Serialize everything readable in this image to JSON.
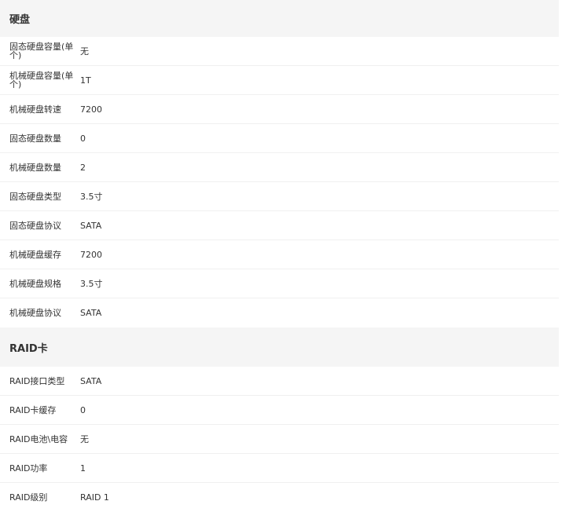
{
  "sections": [
    {
      "title": "硬盘",
      "rows": [
        {
          "label": "固态硬盘容量(单个)",
          "value": "无"
        },
        {
          "label": "机械硬盘容量(单个)",
          "value": "1T"
        },
        {
          "label": "机械硬盘转速",
          "value": "7200"
        },
        {
          "label": "固态硬盘数量",
          "value": "0"
        },
        {
          "label": "机械硬盘数量",
          "value": "2"
        },
        {
          "label": "固态硬盘类型",
          "value": "3.5寸"
        },
        {
          "label": "固态硬盘协议",
          "value": "SATA"
        },
        {
          "label": "机械硬盘缓存",
          "value": "7200"
        },
        {
          "label": "机械硬盘规格",
          "value": "3.5寸"
        },
        {
          "label": "机械硬盘协议",
          "value": "SATA"
        }
      ]
    },
    {
      "title": "RAID卡",
      "rows": [
        {
          "label": "RAID接口类型",
          "value": "SATA"
        },
        {
          "label": "RAID卡缓存",
          "value": "0"
        },
        {
          "label": "RAID电池\\电容",
          "value": "无"
        },
        {
          "label": "RAID功率",
          "value": "1"
        },
        {
          "label": "RAID级别",
          "value": "RAID 1"
        }
      ]
    }
  ]
}
